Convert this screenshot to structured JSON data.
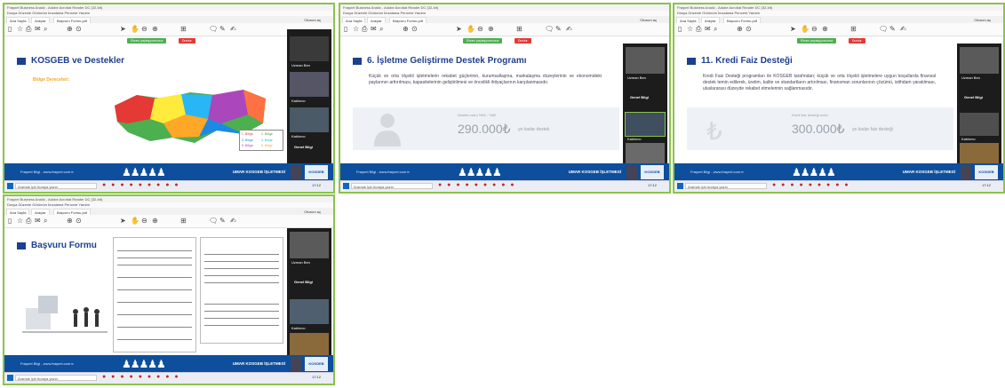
{
  "windows": [
    {
      "title_bar": "Fraşnet Business Analiz - Adobe Acrobat Reader DC (32-bit)",
      "menu": "Dosya  Düzenle  Görünüm  İmzalama  Pencere  Yardım",
      "tabs": [
        "Ana Sayfa",
        "Araçlar",
        "Başvuru Formu.pdf"
      ],
      "sign_in": "Oturum aç",
      "share_green": "Ekranı paylaşıyorsunuz",
      "share_red": "Durdur",
      "slide_title": "KOSGEB ve Destekler",
      "region_label": "Bölge Dereceleri:",
      "legend": [
        "1. Bölge",
        "2. Bölge",
        "3. Bölge",
        "4. Bölge",
        "5. Bölge",
        "6. Bölge"
      ],
      "participants": [
        "Uzman Ben",
        "Katılımcı",
        "Katılımcı",
        "Genel Bilgi"
      ],
      "footer_left": "Fraşnet Bilgi - www.fraşnet.com.tr",
      "footer_right": "UMAR KOSGEB İŞLETMESİ",
      "footer_logo": "KOSGEB",
      "taskbar_search": "Aramak için buraya yazın",
      "taskbar_clock": "17:12"
    },
    {
      "title_bar": "Fraşnet Business Analiz - Adobe Acrobat Reader DC (32-bit)",
      "menu": "Dosya  Düzenle  Görünüm  İmzalama  Pencere  Yardım",
      "tabs": [
        "Ana Sayfa",
        "Araçlar",
        "Başvuru Formu.pdf"
      ],
      "sign_in": "Oturum aç",
      "share_green": "Ekranı paylaşıyorsunuz",
      "share_red": "Durdur",
      "slide_title": "6. İşletme Geliştirme Destek Programı",
      "body": "Küçük ve orta ölçekli işletmelerin rekabet güçlerinin, kurumsallaşma, markalaşma düzeylerinin ve ekonomideki paylarının arttırılması, kapasitelerinin geliştirilmesi ve öncelikli ihtiyaçlarının karşılanmasıdır.",
      "amount": "290.000₺",
      "amount_suffix": "ye kadar destek",
      "amount_note": "Destek oranı %60 - %80",
      "participants": [
        "Uzman Ben",
        "Genel Bilgi",
        "Katılımcı",
        "Katılımcı"
      ],
      "footer_left": "Fraşnet Bilgi - www.fraşnet.com.tr",
      "footer_right": "UMAR KOSGEB İŞLETMESİ",
      "footer_logo": "KOSGEB",
      "taskbar_search": "Aramak için buraya yazın",
      "taskbar_clock": "17:12"
    },
    {
      "title_bar": "Fraşnet Business Analiz - Adobe Acrobat Reader DC (32-bit)",
      "menu": "Dosya  Düzenle  Görünüm  İmzalama  Pencere  Yardım",
      "tabs": [
        "Ana Sayfa",
        "Araçlar",
        "Başvuru Formu.pdf"
      ],
      "sign_in": "Oturum aç",
      "share_green": "Ekranı paylaşıyorsunuz",
      "share_red": "Durdur",
      "slide_title": "11. Kredi Faiz Desteği",
      "body": "Kredi Faiz Desteği programları ile KOSGEB tarafından; küçük ve orta ölçekli işletmelere uygun koşullarda finansal destek temin edilerek, üretim, kalite ve standartların artırılması, finansman sorunlarının çözümü, istihdam yaratılması, uluslararası düzeyde rekabet etmelerinin sağlanmasıdır.",
      "amount": "300.000₺",
      "amount_suffix": "ye kadar faiz desteği",
      "amount_note": "Kredi faiz desteği oranı",
      "participants": [
        "Uzman Ben",
        "Genel Bilgi",
        "Katılımcı",
        "Katılımcı"
      ],
      "footer_left": "Fraşnet Bilgi - www.fraşnet.com.tr",
      "footer_right": "UMAR KOSGEB İŞLETMESİ",
      "footer_logo": "KOSGEB",
      "taskbar_search": "Aramak için buraya yazın",
      "taskbar_clock": "17:12"
    },
    {
      "title_bar": "Fraşnet Business Analiz - Adobe Acrobat Reader DC (32-bit)",
      "menu": "Dosya  Düzenle  Görünüm  İmzalama  Pencere  Yardım",
      "tabs": [
        "Ana Sayfa",
        "Araçlar",
        "Başvuru Formu.pdf"
      ],
      "sign_in": "Oturum aç",
      "share_green": "",
      "share_red": "",
      "slide_title": "Başvuru Formu",
      "participants": [
        "Uzman Ben",
        "Genel Bilgi",
        "Katılımcı",
        "Katılımcı"
      ],
      "footer_left": "Fraşnet Bilgi - www.fraşnet.com.tr",
      "footer_right": "UMAR KOSGEB İŞLETMESİ",
      "footer_logo": "KOSGEB",
      "taskbar_search": "Aramak için buraya yazın",
      "taskbar_clock": "17:12"
    }
  ],
  "colors": {
    "frame": "#8bc34a",
    "slide_title": "#1d3f8f",
    "footer": "#0d4f9c",
    "share_green": "#4caf50",
    "share_red": "#e53935"
  }
}
